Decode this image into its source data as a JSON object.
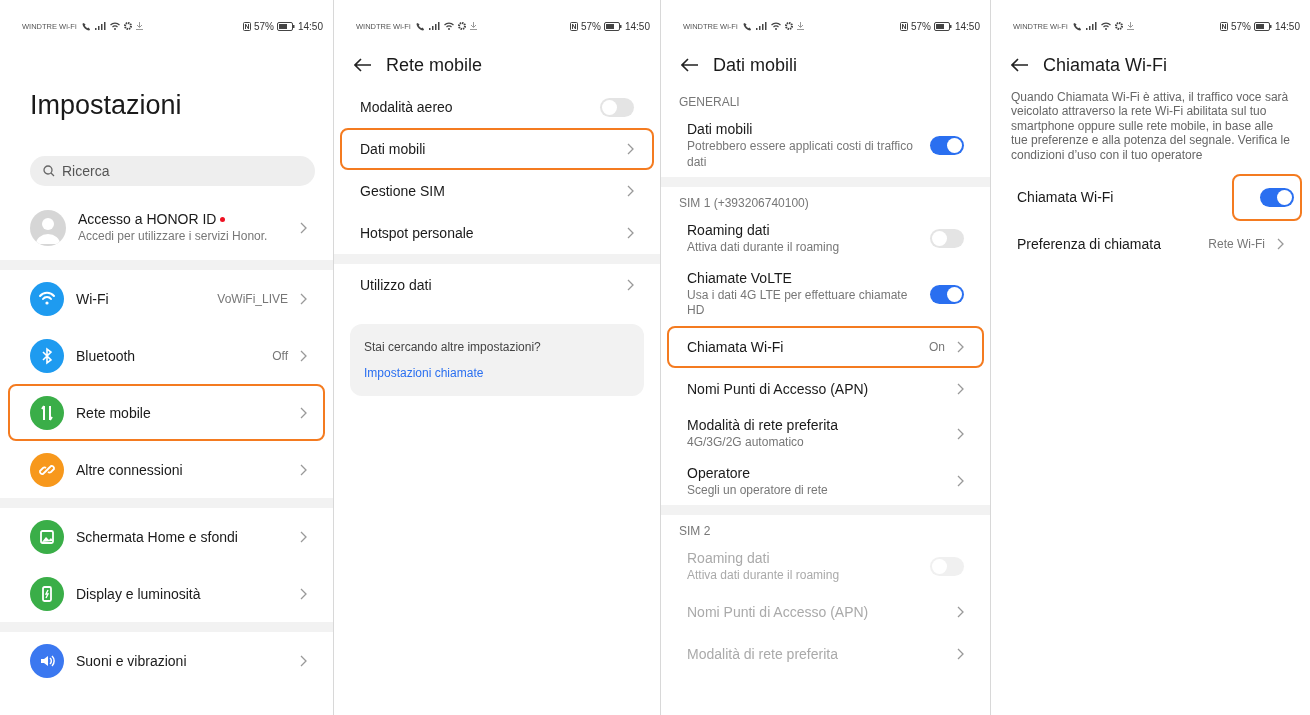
{
  "panels": [
    {
      "status": {
        "carrier": "WINDTRE Wi-Fi",
        "battery": "57%",
        "time": "14:50"
      },
      "kind": "large",
      "title": "Impostazioni",
      "search": {
        "placeholder": "Ricerca"
      },
      "groups": [
        {
          "items": [
            {
              "kind": "account",
              "label": "Accesso a HONOR ID",
              "sub": "Accedi per utilizzare i servizi Honor.",
              "badge": true,
              "highlighted": false
            }
          ]
        },
        {
          "items": [
            {
              "kind": "nav",
              "label": "Wi-Fi",
              "value": "VoWiFi_LIVE",
              "color": "#1e9bf0",
              "highlighted": false
            },
            {
              "kind": "nav",
              "label": "Bluetooth",
              "value": "Off",
              "color": "#1e9bf0",
              "highlighted": false
            },
            {
              "kind": "nav",
              "label": "Rete mobile",
              "color": "#3aae48",
              "highlighted": true
            },
            {
              "kind": "nav",
              "label": "Altre connessioni",
              "color": "#f7981c",
              "highlighted": false
            }
          ]
        },
        {
          "items": [
            {
              "kind": "nav",
              "label": "Schermata Home e sfondi",
              "color": "#3aae48",
              "highlighted": false
            },
            {
              "kind": "nav",
              "label": "Display e luminosità",
              "color": "#3aae48",
              "highlighted": false
            }
          ]
        },
        {
          "items": [
            {
              "kind": "nav",
              "label": "Suoni e vibrazioni",
              "color": "#3b78f0",
              "highlighted": false
            }
          ]
        }
      ]
    },
    {
      "status": {
        "carrier": "WINDTRE Wi-Fi",
        "battery": "57%",
        "time": "14:50"
      },
      "kind": "back",
      "title": "Rete mobile",
      "groups": [
        {
          "items": [
            {
              "kind": "toggle",
              "label": "Modalità aereo",
              "on": false,
              "highlighted": false
            },
            {
              "kind": "nav",
              "label": "Dati mobili",
              "highlighted": true
            },
            {
              "kind": "nav",
              "label": "Gestione SIM",
              "highlighted": false
            },
            {
              "kind": "nav",
              "label": "Hotspot personale",
              "highlighted": false
            }
          ]
        },
        {
          "items": [
            {
              "kind": "nav",
              "label": "Utilizzo dati",
              "highlighted": false
            }
          ]
        }
      ],
      "card": {
        "text": "Stai cercando altre impostazioni?",
        "link": "Impostazioni chiamate"
      }
    },
    {
      "status": {
        "carrier": "WINDTRE Wi-Fi",
        "battery": "57%",
        "time": "14:50"
      },
      "kind": "back",
      "title": "Dati mobili",
      "groups": [
        {
          "header": "GENERALI",
          "items": [
            {
              "kind": "toggle",
              "label": "Dati mobili",
              "sub": "Potrebbero essere applicati costi di traffico dati",
              "on": true,
              "disabled": false,
              "highlighted": false
            }
          ]
        },
        {
          "header": "SIM 1 (+393206740100)",
          "items": [
            {
              "kind": "toggle",
              "label": "Roaming dati",
              "sub": "Attiva dati durante il roaming",
              "on": false,
              "disabled": false,
              "highlighted": false
            },
            {
              "kind": "toggle",
              "label": "Chiamate VoLTE",
              "sub": "Usa i dati 4G LTE per effettuare chiamate HD",
              "on": true,
              "disabled": false,
              "highlighted": false
            },
            {
              "kind": "nav",
              "label": "Chiamata Wi-Fi",
              "value": "On",
              "disabled": false,
              "highlighted": true
            },
            {
              "kind": "nav",
              "label": "Nomi Punti di Accesso (APN)",
              "disabled": false,
              "highlighted": false
            },
            {
              "kind": "nav",
              "label": "Modalità di rete preferita",
              "sub": "4G/3G/2G automatico",
              "disabled": false,
              "highlighted": false
            },
            {
              "kind": "nav",
              "label": "Operatore",
              "sub": "Scegli un operatore di rete",
              "disabled": false,
              "highlighted": false
            }
          ]
        },
        {
          "header": "SIM 2",
          "items": [
            {
              "kind": "toggle",
              "label": "Roaming dati",
              "sub": "Attiva dati durante il roaming",
              "on": false,
              "disabled": true,
              "highlighted": false
            },
            {
              "kind": "nav",
              "label": "Nomi Punti di Accesso (APN)",
              "disabled": true,
              "highlighted": false
            },
            {
              "kind": "nav",
              "label": "Modalità di rete preferita",
              "disabled": true,
              "highlighted": false
            }
          ]
        }
      ]
    },
    {
      "status": {
        "carrier": "WINDTRE Wi-Fi",
        "battery": "57%",
        "time": "14:50"
      },
      "kind": "back",
      "title": "Chiamata Wi-Fi",
      "description": "Quando Chiamata Wi-Fi è attiva, il traffico voce sarà veicolato attraverso la rete Wi-Fi abilitata sul tuo smartphone oppure sulle rete mobile, in base alle tue preferenze e alla potenza del segnale. Verifica le condizioni d’uso con il tuo operatore",
      "groups": [
        {
          "items": [
            {
              "kind": "toggle",
              "label": "Chiamata Wi-Fi",
              "on": true,
              "highlighted": true
            },
            {
              "kind": "nav",
              "label": "Preferenza di chiamata",
              "value": "Rete Wi-Fi",
              "highlighted": false
            }
          ]
        }
      ]
    }
  ]
}
